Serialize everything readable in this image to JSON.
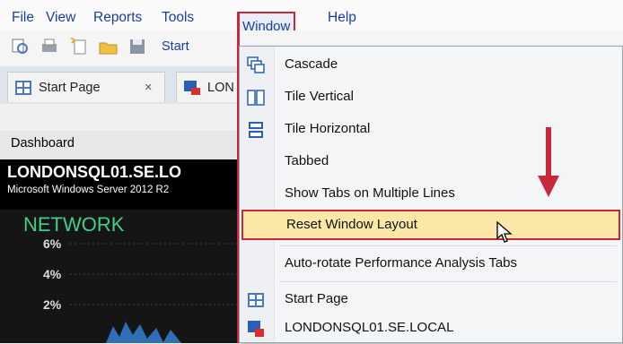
{
  "menubar": {
    "file": "File",
    "view": "View",
    "reports": "Reports",
    "tools": "Tools",
    "window": "Window",
    "help": "Help"
  },
  "toolbar": {
    "start_label": "Start"
  },
  "tabs": [
    {
      "label": "Start Page",
      "close": "×"
    },
    {
      "label": "LON"
    }
  ],
  "dashboard": {
    "label": "Dashboard",
    "server": "LONDONSQL01.SE.LO",
    "os": "Microsoft Windows Server 2012 R2",
    "section": "NETWORK",
    "yticks": [
      "6%",
      "4%",
      "2%"
    ]
  },
  "window_menu": {
    "items": [
      {
        "label": "Cascade",
        "icon": "cascade-icon"
      },
      {
        "label": "Tile Vertical",
        "icon": "tile-vertical-icon"
      },
      {
        "label": "Tile Horizontal",
        "icon": "tile-horizontal-icon"
      },
      {
        "label": "Tabbed"
      },
      {
        "label": "Show Tabs on Multiple Lines"
      },
      {
        "label": "Reset Window Layout"
      },
      {
        "label": "Auto-rotate Performance Analysis Tabs"
      },
      {
        "label": "Start Page",
        "icon": "start-page-icon"
      },
      {
        "label": "LONDONSQL01.SE.LOCAL",
        "icon": "server-icon"
      }
    ]
  },
  "colors": {
    "highlight_border": "#c8283c",
    "highlight_fill": "#fbe8a6",
    "menu_text": "#1a3f9a",
    "network_title": "#3fd08a"
  }
}
